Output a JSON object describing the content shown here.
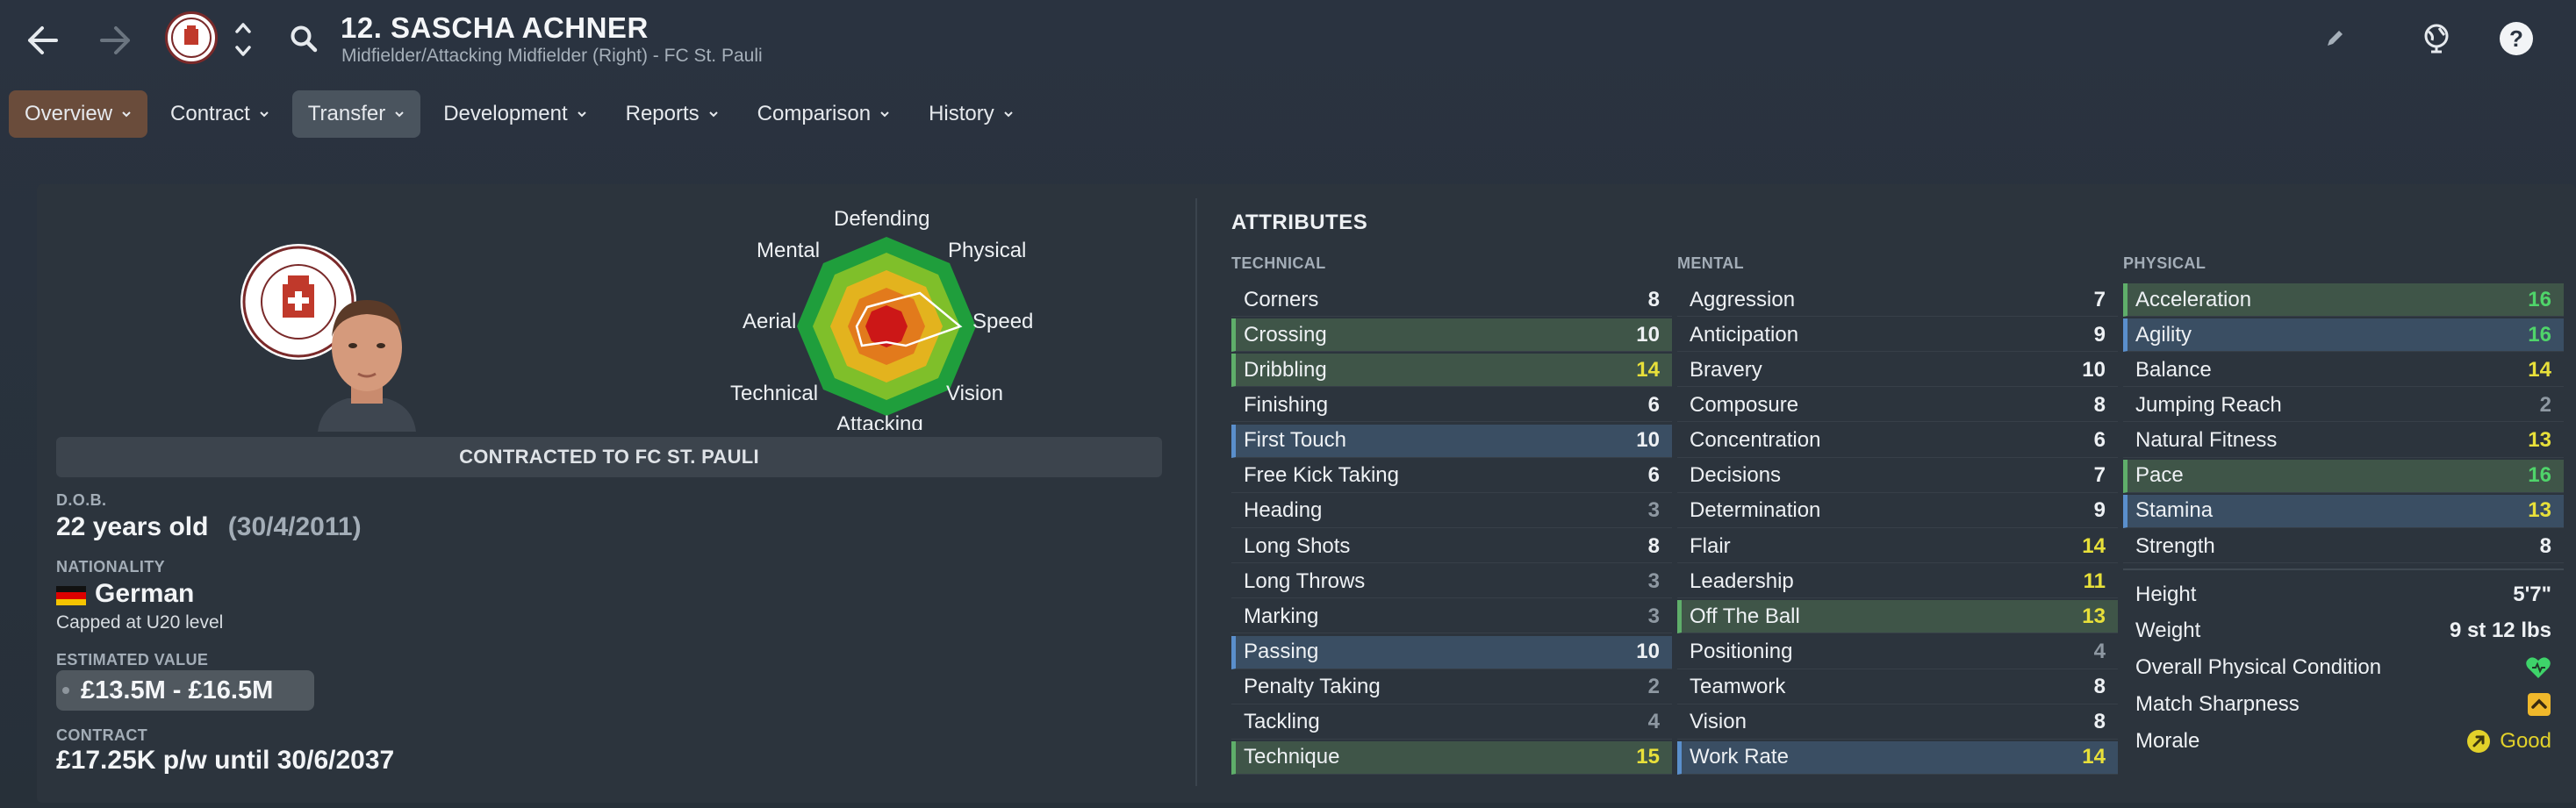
{
  "header": {
    "title": "12. SASCHA ACHNER",
    "subtitle": "Midfielder/Attacking Midfielder (Right) - FC St. Pauli",
    "crest_small_text": "FC ST. PAULI 1910"
  },
  "icons": [
    "back-arrow-icon",
    "forward-arrow-icon",
    "club-crest",
    "sort-chevrons-icon",
    "search-icon",
    "edit-pencil-icon",
    "globe-icon",
    "help-icon"
  ],
  "tabs": [
    {
      "label": "Overview",
      "state": "active"
    },
    {
      "label": "Contract",
      "state": "normal"
    },
    {
      "label": "Transfer",
      "state": "hover"
    },
    {
      "label": "Development",
      "state": "normal"
    },
    {
      "label": "Reports",
      "state": "normal"
    },
    {
      "label": "Comparison",
      "state": "normal"
    },
    {
      "label": "History",
      "state": "normal"
    }
  ],
  "overview": {
    "crest_text": "FC ST. PAULI 1910",
    "contracted_label": "CONTRACTED TO FC ST. PAULI",
    "dob_label": "D.O.B.",
    "age": "22 years old",
    "dob": "(30/4/2011)",
    "nationality_label": "NATIONALITY",
    "nationality": "German",
    "caps": "Capped at U20 level",
    "value_label": "ESTIMATED VALUE",
    "value": "£13.5M - £16.5M",
    "contract_label": "CONTRACT",
    "contract": "£17.25K p/w until 30/6/2037"
  },
  "radar": {
    "labels": [
      "Defending",
      "Physical",
      "Speed",
      "Vision",
      "Attacking",
      "Technical",
      "Aerial",
      "Mental"
    ]
  },
  "attributes": {
    "heading": "ATTRIBUTES",
    "technical_label": "TECHNICAL",
    "mental_label": "MENTAL",
    "physical_label": "PHYSICAL",
    "technical": [
      {
        "name": "Corners",
        "value": "8",
        "hl": "",
        "color": "white"
      },
      {
        "name": "Crossing",
        "value": "10",
        "hl": "green",
        "color": "white"
      },
      {
        "name": "Dribbling",
        "value": "14",
        "hl": "green",
        "color": "yellow"
      },
      {
        "name": "Finishing",
        "value": "6",
        "hl": "",
        "color": "white"
      },
      {
        "name": "First Touch",
        "value": "10",
        "hl": "blue",
        "color": "white"
      },
      {
        "name": "Free Kick Taking",
        "value": "6",
        "hl": "",
        "color": "white"
      },
      {
        "name": "Heading",
        "value": "3",
        "hl": "",
        "color": "grey"
      },
      {
        "name": "Long Shots",
        "value": "8",
        "hl": "",
        "color": "white"
      },
      {
        "name": "Long Throws",
        "value": "3",
        "hl": "",
        "color": "grey"
      },
      {
        "name": "Marking",
        "value": "3",
        "hl": "",
        "color": "grey"
      },
      {
        "name": "Passing",
        "value": "10",
        "hl": "blue",
        "color": "white"
      },
      {
        "name": "Penalty Taking",
        "value": "2",
        "hl": "",
        "color": "grey"
      },
      {
        "name": "Tackling",
        "value": "4",
        "hl": "",
        "color": "grey"
      },
      {
        "name": "Technique",
        "value": "15",
        "hl": "green",
        "color": "yellow"
      }
    ],
    "mental": [
      {
        "name": "Aggression",
        "value": "7",
        "hl": "",
        "color": "white"
      },
      {
        "name": "Anticipation",
        "value": "9",
        "hl": "",
        "color": "white"
      },
      {
        "name": "Bravery",
        "value": "10",
        "hl": "",
        "color": "white"
      },
      {
        "name": "Composure",
        "value": "8",
        "hl": "",
        "color": "white"
      },
      {
        "name": "Concentration",
        "value": "6",
        "hl": "",
        "color": "white"
      },
      {
        "name": "Decisions",
        "value": "7",
        "hl": "",
        "color": "white"
      },
      {
        "name": "Determination",
        "value": "9",
        "hl": "",
        "color": "white"
      },
      {
        "name": "Flair",
        "value": "14",
        "hl": "",
        "color": "yellow"
      },
      {
        "name": "Leadership",
        "value": "11",
        "hl": "",
        "color": "yellow"
      },
      {
        "name": "Off The Ball",
        "value": "13",
        "hl": "green",
        "color": "yellow"
      },
      {
        "name": "Positioning",
        "value": "4",
        "hl": "",
        "color": "grey"
      },
      {
        "name": "Teamwork",
        "value": "8",
        "hl": "",
        "color": "white"
      },
      {
        "name": "Vision",
        "value": "8",
        "hl": "",
        "color": "white"
      },
      {
        "name": "Work Rate",
        "value": "14",
        "hl": "blue",
        "color": "yellow"
      }
    ],
    "physical": [
      {
        "name": "Acceleration",
        "value": "16",
        "hl": "green",
        "color": "green"
      },
      {
        "name": "Agility",
        "value": "16",
        "hl": "blue",
        "color": "green"
      },
      {
        "name": "Balance",
        "value": "14",
        "hl": "",
        "color": "yellow"
      },
      {
        "name": "Jumping Reach",
        "value": "2",
        "hl": "",
        "color": "grey"
      },
      {
        "name": "Natural Fitness",
        "value": "13",
        "hl": "",
        "color": "yellow"
      },
      {
        "name": "Pace",
        "value": "16",
        "hl": "green",
        "color": "green"
      },
      {
        "name": "Stamina",
        "value": "13",
        "hl": "blue",
        "color": "yellow"
      },
      {
        "name": "Strength",
        "value": "8",
        "hl": "",
        "color": "white"
      }
    ],
    "info": {
      "height_label": "Height",
      "height": "5'7\"",
      "weight_label": "Weight",
      "weight": "9 st 12 lbs",
      "condition_label": "Overall Physical Condition",
      "sharpness_label": "Match Sharpness",
      "morale_label": "Morale",
      "morale": "Good"
    }
  },
  "colors": {
    "accent_tab": "#6a4c3b",
    "value_yellow": "#e8e03a",
    "value_green": "#4fd46a",
    "highlight_green": "#3f5548",
    "highlight_blue": "#3a4e63"
  }
}
